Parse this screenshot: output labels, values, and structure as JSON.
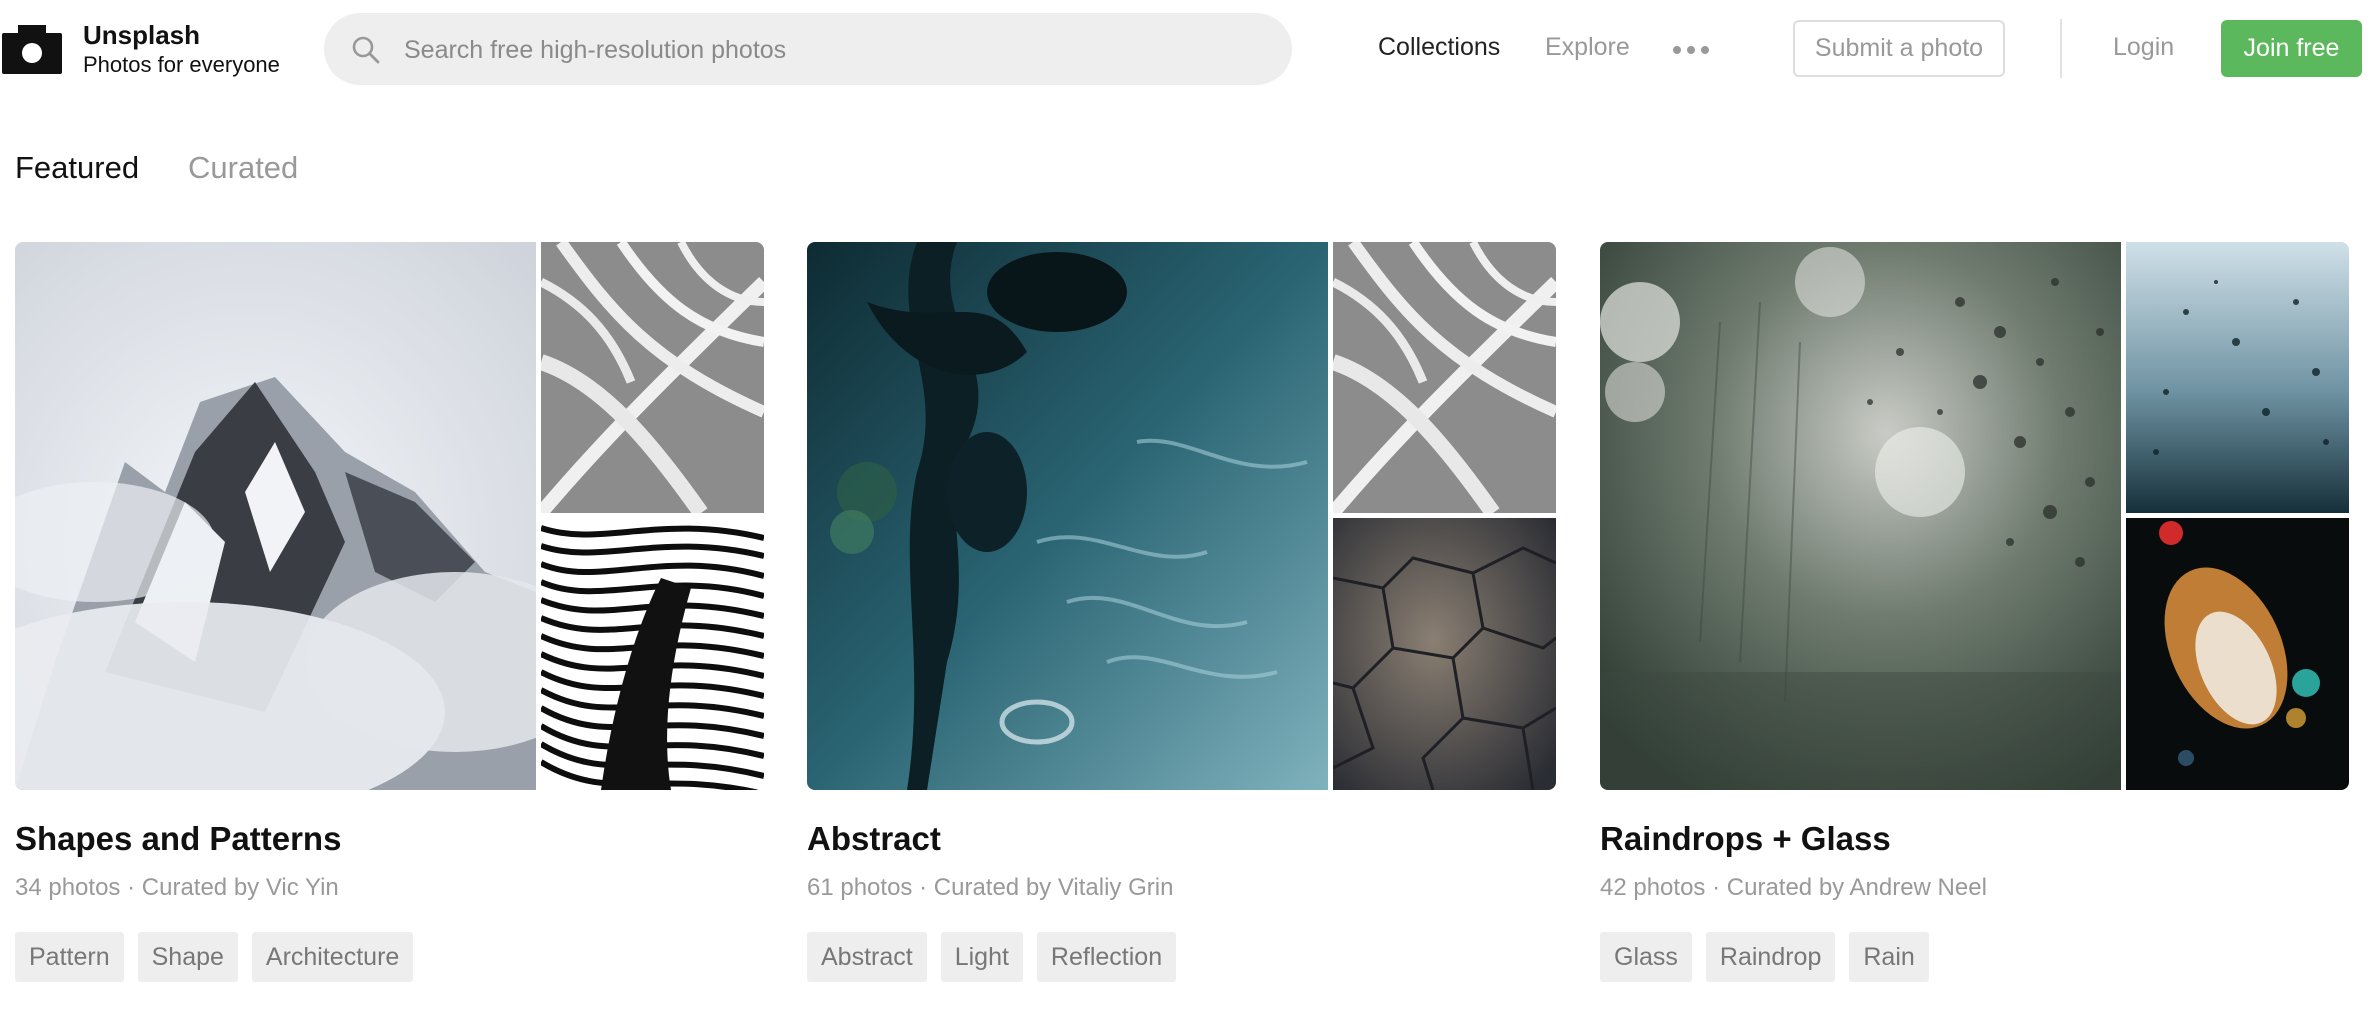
{
  "brand": {
    "name": "Unsplash",
    "tagline": "Photos for everyone"
  },
  "search": {
    "placeholder": "Search free high-resolution photos",
    "value": ""
  },
  "nav": {
    "collections": "Collections",
    "explore": "Explore",
    "more_icon": "more-dots-icon",
    "submit": "Submit a photo",
    "login": "Login",
    "join": "Join free"
  },
  "tabs": [
    {
      "label": "Featured",
      "active": true
    },
    {
      "label": "Curated",
      "active": false
    }
  ],
  "collections": [
    {
      "title": "Shapes and Patterns",
      "count": "34 photos",
      "curator": "Curated by Vic Yin",
      "tags": [
        "Pattern",
        "Shape",
        "Architecture"
      ],
      "photos": [
        "snowy-mountain-peaks",
        "palm-leaf-shadow",
        "striped-wave-pattern"
      ]
    },
    {
      "title": "Abstract",
      "count": "61 photos",
      "curator": "Curated by Vitaliy Grin",
      "tags": [
        "Abstract",
        "Light",
        "Reflection"
      ],
      "photos": [
        "teal-water-reflection",
        "palm-leaf-shadow",
        "cracked-stone-texture"
      ]
    },
    {
      "title": "Raindrops + Glass",
      "count": "42 photos",
      "curator": "Curated by Andrew Neel",
      "tags": [
        "Glass",
        "Raindrop",
        "Rain"
      ],
      "photos": [
        "rain-on-window",
        "blue-raindrops",
        "bokeh-rain-lights"
      ]
    }
  ],
  "meta_separator": "·",
  "colors": {
    "accent_green": "#5cb85c",
    "muted_text": "#999999",
    "search_bg": "#eeeeee",
    "tag_bg": "#eeeeee"
  }
}
